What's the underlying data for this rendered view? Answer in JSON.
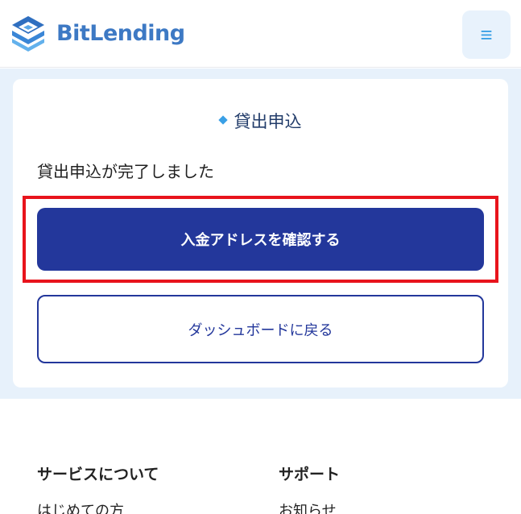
{
  "header": {
    "logo_text": "BitLending",
    "menu_icon": "≡"
  },
  "card": {
    "title": "貸出申込",
    "message": "貸出申込が完了しました",
    "primary_button": "入金アドレスを確認する",
    "secondary_button": "ダッシュボードに戻る"
  },
  "footer": {
    "columns": [
      {
        "heading": "サービスについて",
        "links": [
          "はじめての方"
        ]
      },
      {
        "heading": "サポート",
        "links": [
          "お知らせ"
        ]
      }
    ]
  },
  "colors": {
    "brand": "#3d79c4",
    "primary": "#23379b",
    "accent": "#3aa0e6",
    "highlight": "#e8141c",
    "band": "#e7f1fb"
  },
  "icons": {
    "logo": "bitlending-logo-icon",
    "menu": "hamburger-menu-icon",
    "title_marker": "diamond-icon"
  }
}
